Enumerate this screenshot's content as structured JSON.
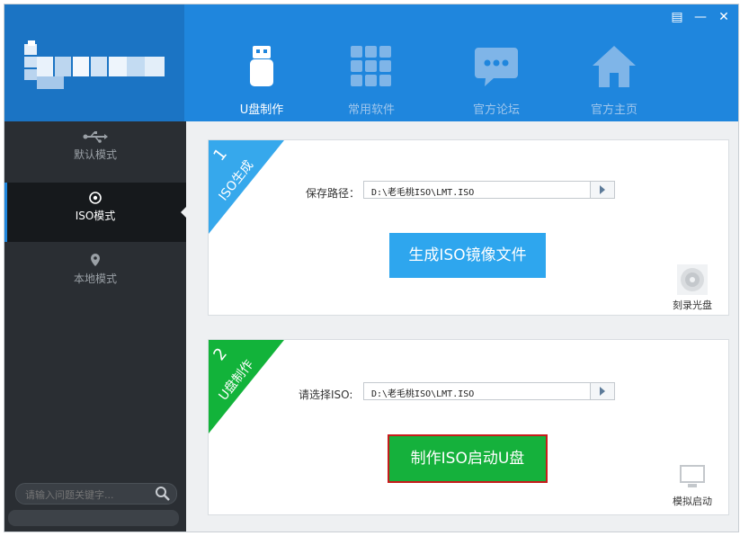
{
  "window": {
    "controls": [
      "▤",
      "—",
      "✕"
    ]
  },
  "tabs": [
    {
      "label": "U盘制作",
      "icon": "usb-drive-icon",
      "active": true
    },
    {
      "label": "常用软件",
      "icon": "grid-apps-icon",
      "active": false
    },
    {
      "label": "官方论坛",
      "icon": "chat-bubble-icon",
      "active": false
    },
    {
      "label": "官方主页",
      "icon": "home-icon",
      "active": false
    }
  ],
  "sidebar": {
    "items": [
      {
        "label": "默认模式",
        "icon": "usb-symbol-icon",
        "active": false
      },
      {
        "label": "ISO模式",
        "icon": "disc-icon",
        "active": true
      },
      {
        "label": "本地模式",
        "icon": "location-pin-icon",
        "active": false
      }
    ],
    "search": {
      "placeholder": "请输入问题关键字..."
    }
  },
  "panel1": {
    "step": "1",
    "title": "ISO生成",
    "field_label": "保存路径：",
    "path": "D:\\老毛桃ISO\\LMT.ISO",
    "button": "生成ISO镜像文件",
    "side_action": "刻录光盘",
    "corner_color": "#36a8ec"
  },
  "panel2": {
    "step": "2",
    "title": "U盘制作",
    "field_label": "请选择ISO:",
    "path": "D:\\老毛桃ISO\\LMT.ISO",
    "button": "制作ISO启动U盘",
    "side_action": "模拟启动",
    "corner_color": "#12b33a"
  },
  "colors": {
    "header": "#1f86dd",
    "sidebar": "#2a2e33",
    "accent_blue": "#2ea6ee",
    "accent_green": "#15b13c",
    "highlight_red": "#c71b1b"
  }
}
